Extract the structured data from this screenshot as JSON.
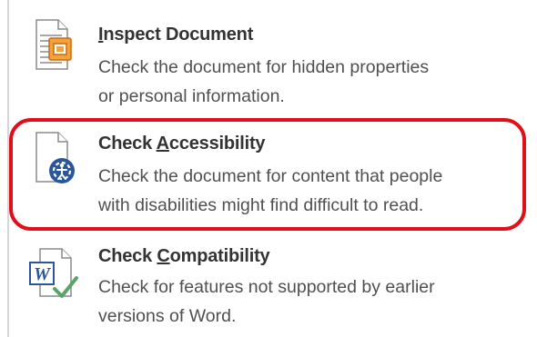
{
  "menu": {
    "items": [
      {
        "title_pre": "",
        "title_key": "I",
        "title_post": "nspect Document",
        "description_line1": "Check the document for hidden properties",
        "description_line2": "or personal information.",
        "icon": "inspect-document-icon"
      },
      {
        "title_pre": "Check ",
        "title_key": "A",
        "title_post": "ccessibility",
        "description_line1": "Check the document for content that people",
        "description_line2": "with disabilities might find difficult to read.",
        "icon": "check-accessibility-icon",
        "highlighted": true
      },
      {
        "title_pre": "Check ",
        "title_key": "C",
        "title_post": "ompatibility",
        "description_line1": "Check for features not supported by earlier",
        "description_line2": "versions of Word.",
        "icon": "check-compatibility-icon"
      }
    ]
  },
  "colors": {
    "highlight": "#e0101b",
    "title_text": "#333333",
    "description_text": "#505050",
    "accent_blue": "#2b579a",
    "check_green": "#5aa469"
  }
}
